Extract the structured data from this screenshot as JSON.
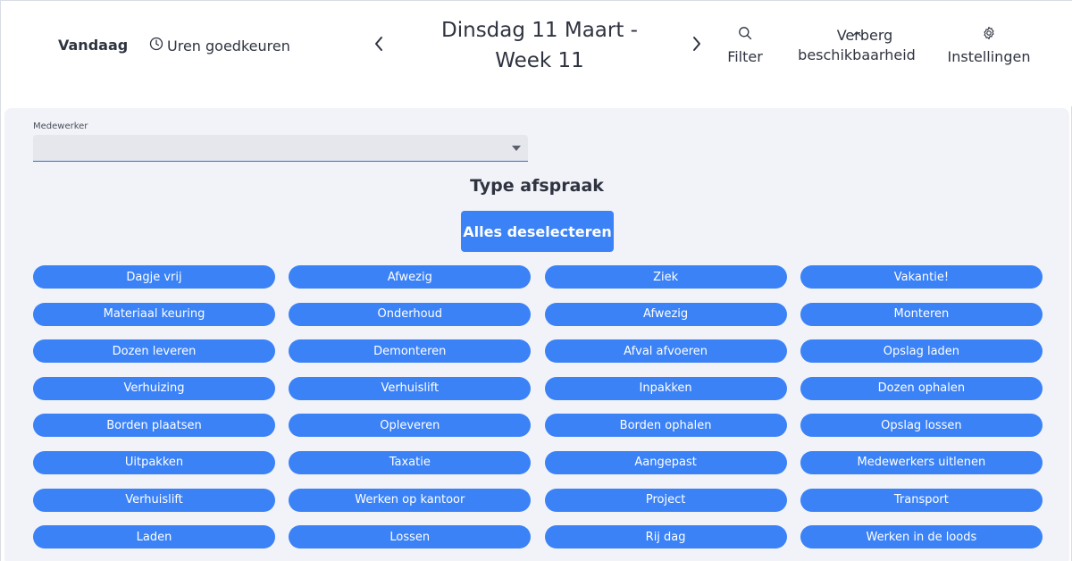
{
  "header": {
    "today_label": "Vandaag",
    "approve_hours_label": "Uren goedkeuren",
    "date_title": "Dinsdag 11 Maart - Week 11",
    "filter_label": "Filter",
    "hide_availability_label": "Verberg beschikbaarheid",
    "settings_label": "Instellingen"
  },
  "form": {
    "employee_label": "Medewerker",
    "employee_value": ""
  },
  "appointment_type": {
    "title": "Type afspraak",
    "deselect_all_label": "Alles deselecteren",
    "button_color": "#3b82f6",
    "types": [
      "Dagje vrij",
      "Afwezig",
      "Ziek",
      "Vakantie!",
      "Materiaal keuring",
      "Onderhoud",
      "Afwezig",
      "Monteren",
      "Dozen leveren",
      "Demonteren",
      "Afval afvoeren",
      "Opslag laden",
      "Verhuizing",
      "Verhuislift",
      "Inpakken",
      "Dozen ophalen",
      "Borden plaatsen",
      "Opleveren",
      "Borden ophalen",
      "Opslag lossen",
      "Uitpakken",
      "Taxatie",
      "Aangepast",
      "Medewerkers uitlenen",
      "Verhuislift",
      "Werken op kantoor",
      "Project",
      "Transport",
      "Laden",
      "Lossen",
      "Rij dag",
      "Werken in de loods"
    ]
  }
}
